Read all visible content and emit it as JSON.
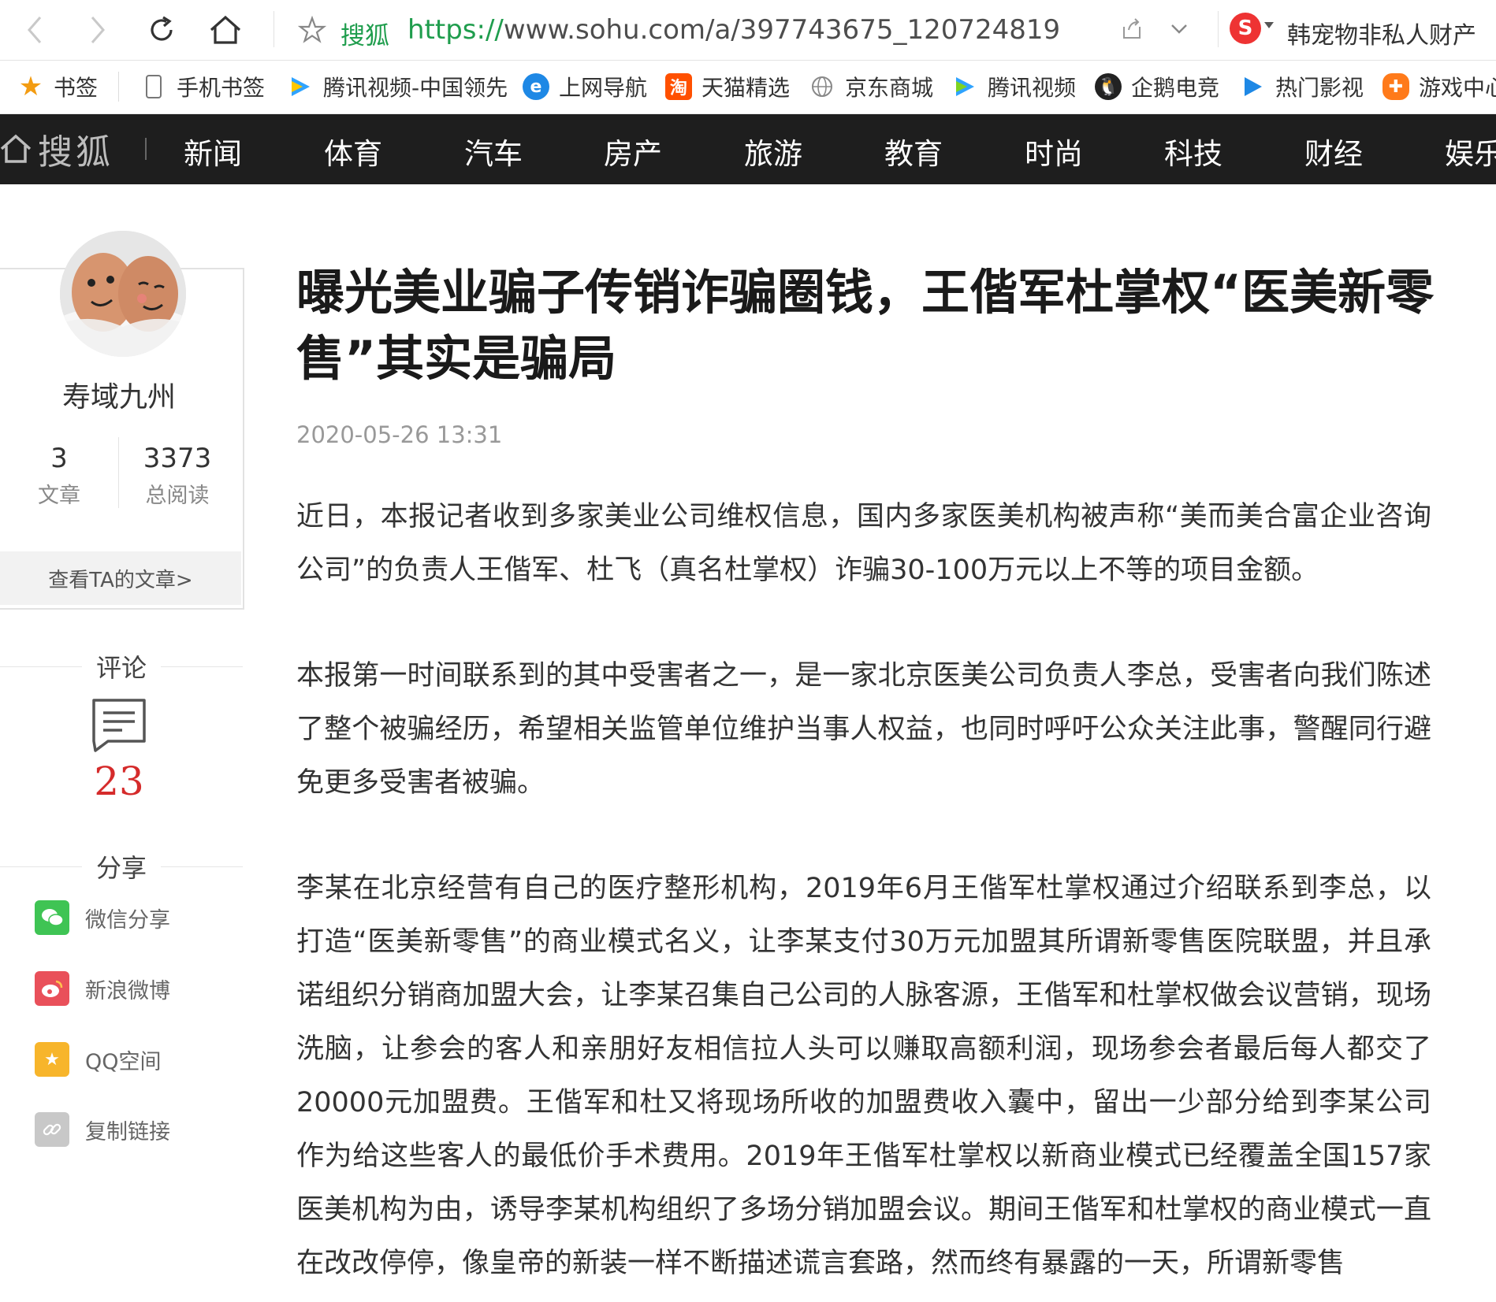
{
  "browser": {
    "site_tag": "搜狐",
    "url_proto": "https://",
    "url_rest": "www.sohu.com/a/397743675_120724819",
    "search_hint": "韩宠物非私人财产"
  },
  "bookmarks": [
    {
      "label": "书签",
      "icon": "star-icon",
      "color": "#f39c12"
    },
    {
      "label": "手机书签",
      "icon": "phone-icon",
      "color": "#888888"
    },
    {
      "label": "腾讯视频-中国领先",
      "icon": "tencent-video-icon",
      "color": "#2fa3ff"
    },
    {
      "label": "上网导航",
      "icon": "ie-icon",
      "color": "#1e88e5"
    },
    {
      "label": "天猫精选",
      "icon": "taobao-icon",
      "color": "#ff5000"
    },
    {
      "label": "京东商城",
      "icon": "globe-icon",
      "color": "#888888"
    },
    {
      "label": "腾讯视频",
      "icon": "tencent-video-icon",
      "color": "#2fa3ff"
    },
    {
      "label": "企鹅电竞",
      "icon": "penguin-icon",
      "color": "#333333"
    },
    {
      "label": "热门影视",
      "icon": "play-icon",
      "color": "#1e88e5"
    },
    {
      "label": "游戏中心",
      "icon": "gamepad-icon",
      "color": "#ff7a1a"
    }
  ],
  "site": {
    "logo": "搜狐",
    "categories": [
      "新闻",
      "体育",
      "汽车",
      "房产",
      "旅游",
      "教育",
      "时尚",
      "科技",
      "财经",
      "娱乐"
    ]
  },
  "author": {
    "name": "寿域九州",
    "articles_count": "3",
    "articles_label": "文章",
    "reads_count": "3373",
    "reads_label": "总阅读",
    "view_articles": "查看TA的文章>"
  },
  "comments": {
    "title": "评论",
    "count": "23"
  },
  "share": {
    "title": "分享",
    "items": [
      {
        "label": "微信分享",
        "icon": "wechat-icon",
        "color": "#3fc454"
      },
      {
        "label": "新浪微博",
        "icon": "weibo-icon",
        "color": "#e9505a"
      },
      {
        "label": "QQ空间",
        "icon": "qzone-icon",
        "color": "#f7b52b"
      },
      {
        "label": "复制链接",
        "icon": "link-icon",
        "color": "#c8c8c8"
      }
    ]
  },
  "article": {
    "title": "曝光美业骗子传销诈骗圈钱，王偕军杜掌权“医美新零售”其实是骗局",
    "date": "2020-05-26 13:31",
    "paragraphs": [
      "近日，本报记者收到多家美业公司维权信息，国内多家医美机构被声称“美而美合富企业咨询公司”的负责人王偕军、杜飞（真名杜掌权）诈骗30-100万元以上不等的项目金额。",
      "本报第一时间联系到的其中受害者之一，是一家北京医美公司负责人李总，受害者向我们陈述了整个被骗经历，希望相关监管单位维护当事人权益，也同时呼吁公众关注此事，警醒同行避免更多受害者被骗。",
      "李某在北京经营有自己的医疗整形机构，2019年6月王偕军杜掌权通过介绍联系到李总，以打造“医美新零售”的商业模式名义，让李某支付30万元加盟其所谓新零售医院联盟，并且承诺组织分销商加盟大会，让李某召集自己公司的人脉客源，王偕军和杜掌权做会议营销，现场洗脑，让参会的客人和亲朋好友相信拉人头可以赚取高额利润，现场参会者最后每人都交了20000元加盟费。王偕军和杜又将现场所收的加盟费收入囊中，留出一少部分给到李某公司作为给这些客人的最低价手术费用。2019年王偕军杜掌权以新商业模式已经覆盖全国157家医美机构为由，诱导李某机构组织了多场分销加盟会议。期间王偕军和杜掌权的商业模式一直在改改停停，像皇帝的新装一样不断描述谎言套路，然而终有暴露的一天，所谓新零售"
    ]
  }
}
